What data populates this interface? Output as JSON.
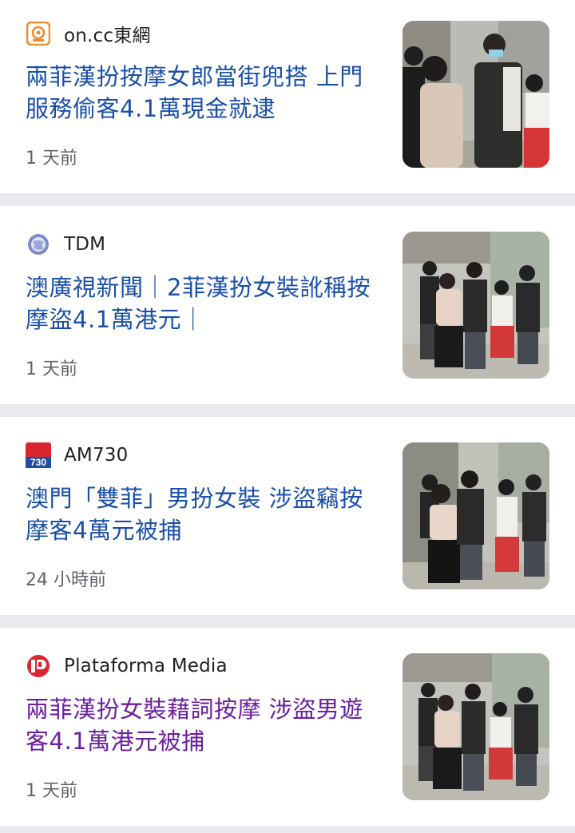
{
  "articles": [
    {
      "source": "on.cc東網",
      "icon": "oncc-logo-icon",
      "headline": "兩菲漢扮按摩女郎當街兜搭 上門服務偷客4.1萬現金就逮",
      "time": "1 天前",
      "visited": false
    },
    {
      "source": "TDM",
      "icon": "globe-icon",
      "headline": "澳廣視新聞｜2菲漢扮女裝訛稱按摩盜4.1萬港元｜",
      "time": "1 天前",
      "visited": false
    },
    {
      "source": "AM730",
      "icon": "am730-logo-icon",
      "headline": "澳門「雙菲」男扮女裝 涉盜竊按摩客4萬元被捕",
      "time": "24 小時前",
      "visited": false
    },
    {
      "source": "Plataforma Media",
      "icon": "plataforma-logo-icon",
      "headline": "兩菲漢扮女裝藉詞按摩 涉盜男遊客4.1萬港元被捕",
      "time": "1 天前",
      "visited": true
    }
  ],
  "logo_text": {
    "am730": "730"
  },
  "colors": {
    "headline": "#1a4fa8",
    "headline_visited": "#6a1ea0",
    "oncc": "#f08a24",
    "am730": "#d7262e",
    "plataforma": "#d7262e"
  }
}
